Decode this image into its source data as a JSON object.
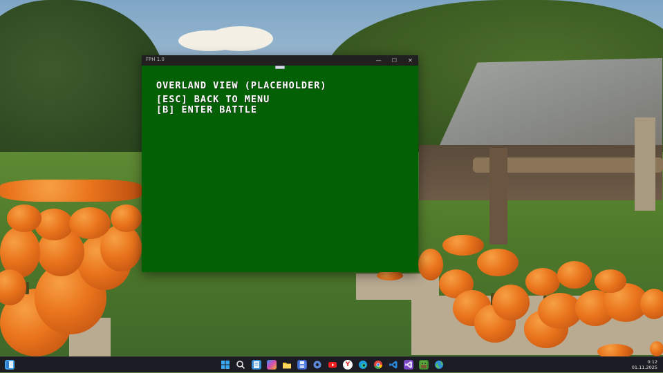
{
  "window": {
    "title": "FPH 1.0",
    "controls": {
      "minimize": "—",
      "maximize": "☐",
      "close": "✕"
    }
  },
  "game": {
    "heading": "OVERLAND VIEW (PLACEHOLDER)",
    "lines": [
      "[ESC] BACK TO MENU",
      "[B] ENTER BATTLE"
    ]
  },
  "taskbar": {
    "clock": {
      "time": "0:12",
      "date": "01.11.2025"
    },
    "apps": [
      "widgets-icon",
      "start-icon",
      "search-icon",
      "notepad-icon",
      "copilot-icon",
      "file-explorer-icon",
      "save-icon",
      "settings-app-icon",
      "youtube-icon",
      "yandex-browser-icon",
      "edge-icon",
      "chrome-icon",
      "vscode-icon",
      "visual-studio-icon",
      "minecraft-icon",
      "globe-app-icon"
    ]
  },
  "colors": {
    "game_background": "#046004",
    "titlebar": "#202020",
    "taskbar": "#1c1c24"
  }
}
